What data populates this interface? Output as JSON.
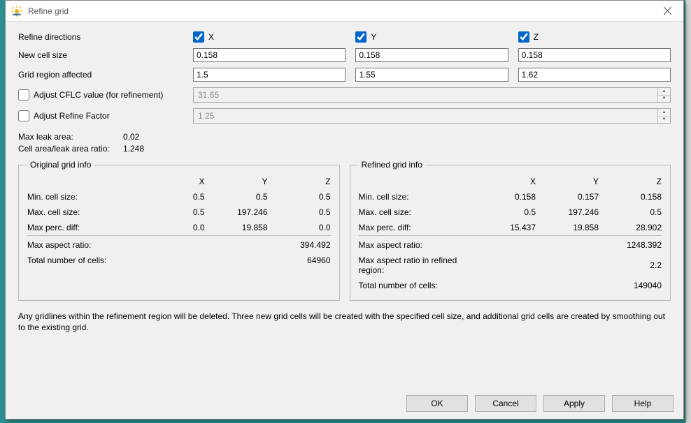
{
  "title": "Refine grid",
  "labels": {
    "refine_directions": "Refine directions",
    "new_cell_size": "New cell size",
    "grid_region": "Grid region affected",
    "adjust_cflc": "Adjust CFLC value (for refinement)",
    "adjust_rf": "Adjust Refine Factor",
    "max_leak": "Max leak area:",
    "cell_ratio": "Cell area/leak area ratio:"
  },
  "dir": {
    "x": "X",
    "y": "Y",
    "z": "Z",
    "x_on": true,
    "y_on": true,
    "z_on": true
  },
  "cell_size": {
    "x": "0.158",
    "y": "0.158",
    "z": "0.158"
  },
  "region": {
    "x": "1.5",
    "y": "1.55",
    "z": "1.62"
  },
  "cflc": {
    "checked": false,
    "value": "31.65"
  },
  "rf": {
    "checked": false,
    "value": "1.25"
  },
  "max_leak_val": "0.02",
  "cell_ratio_val": "1.248",
  "orig": {
    "legend": "Original grid info",
    "rows": {
      "min_label": "Min. cell size:",
      "min": {
        "x": "0.5",
        "y": "0.5",
        "z": "0.5"
      },
      "max_label": "Max. cell size:",
      "max": {
        "x": "0.5",
        "y": "197.246",
        "z": "0.5"
      },
      "pd_label": "Max perc. diff:",
      "pd": {
        "x": "0.0",
        "y": "19.858",
        "z": "0.0"
      }
    },
    "aspect_label": "Max aspect ratio:",
    "aspect": "394.492",
    "total_label": "Total number of cells:",
    "total": "64960",
    "hx": "X",
    "hy": "Y",
    "hz": "Z"
  },
  "ref": {
    "legend": "Refined grid info",
    "rows": {
      "min_label": "Min. cell size:",
      "min": {
        "x": "0.158",
        "y": "0.157",
        "z": "0.158"
      },
      "max_label": "Max. cell size:",
      "max": {
        "x": "0.5",
        "y": "197.246",
        "z": "0.5"
      },
      "pd_label": "Max perc. diff:",
      "pd": {
        "x": "15.437",
        "y": "19.858",
        "z": "28.902"
      }
    },
    "aspect_label": "Max aspect ratio:",
    "aspect": "1248.392",
    "aspect_rr_label": "Max aspect ratio in refined region:",
    "aspect_rr": "2.2",
    "total_label": "Total number of cells:",
    "total": "149040",
    "hx": "X",
    "hy": "Y",
    "hz": "Z"
  },
  "note": "Any gridlines within the refinement region will be deleted. Three new grid cells will be created with the specified cell size, and additional grid cells are created by smoothing out to the existing grid.",
  "buttons": {
    "ok": "OK",
    "cancel": "Cancel",
    "apply": "Apply",
    "help": "Help"
  }
}
